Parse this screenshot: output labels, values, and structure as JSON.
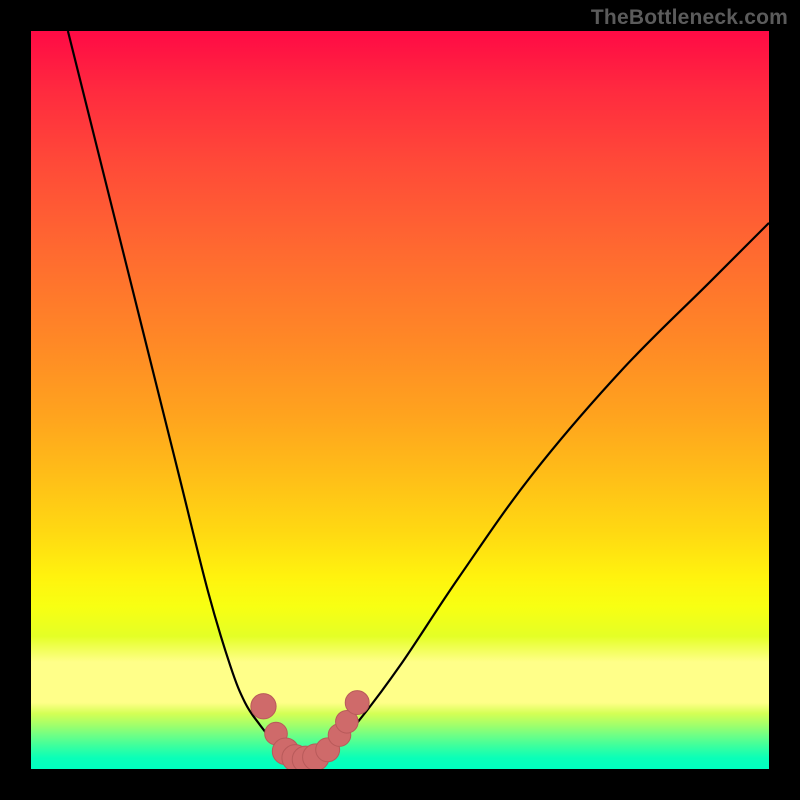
{
  "watermark": "TheBottleneck.com",
  "colors": {
    "frame": "#000000",
    "curve": "#000000",
    "marker_fill": "#cf6a6a",
    "marker_stroke": "#b85a5a"
  },
  "chart_data": {
    "type": "line",
    "title": "",
    "xlabel": "",
    "ylabel": "",
    "xlim": [
      0,
      100
    ],
    "ylim": [
      0,
      100
    ],
    "grid": false,
    "legend": false,
    "background": "rainbow-gradient (red top → green bottom)",
    "series": [
      {
        "name": "left-branch",
        "x": [
          5,
          10,
          15,
          20,
          24,
          27,
          29,
          31,
          33,
          34.5
        ],
        "y": [
          100,
          80,
          60,
          40,
          24,
          14,
          9,
          6,
          3.5,
          2
        ]
      },
      {
        "name": "valley-floor",
        "x": [
          34.5,
          36,
          37.5,
          39,
          40.5
        ],
        "y": [
          2,
          1.2,
          1.0,
          1.3,
          2.2
        ]
      },
      {
        "name": "right-branch",
        "x": [
          40.5,
          44,
          50,
          58,
          68,
          80,
          92,
          100
        ],
        "y": [
          2.2,
          6,
          14,
          26,
          40,
          54,
          66,
          74
        ]
      }
    ],
    "markers": [
      {
        "x": 31.5,
        "y": 8.5,
        "r": 1.3
      },
      {
        "x": 33.2,
        "y": 4.8,
        "r": 1.1
      },
      {
        "x": 34.5,
        "y": 2.4,
        "r": 1.4
      },
      {
        "x": 35.8,
        "y": 1.5,
        "r": 1.4
      },
      {
        "x": 37.2,
        "y": 1.3,
        "r": 1.4
      },
      {
        "x": 38.6,
        "y": 1.6,
        "r": 1.4
      },
      {
        "x": 40.2,
        "y": 2.6,
        "r": 1.2
      },
      {
        "x": 41.8,
        "y": 4.6,
        "r": 1.1
      },
      {
        "x": 42.8,
        "y": 6.4,
        "r": 1.1
      },
      {
        "x": 44.2,
        "y": 9.0,
        "r": 1.2
      }
    ]
  }
}
